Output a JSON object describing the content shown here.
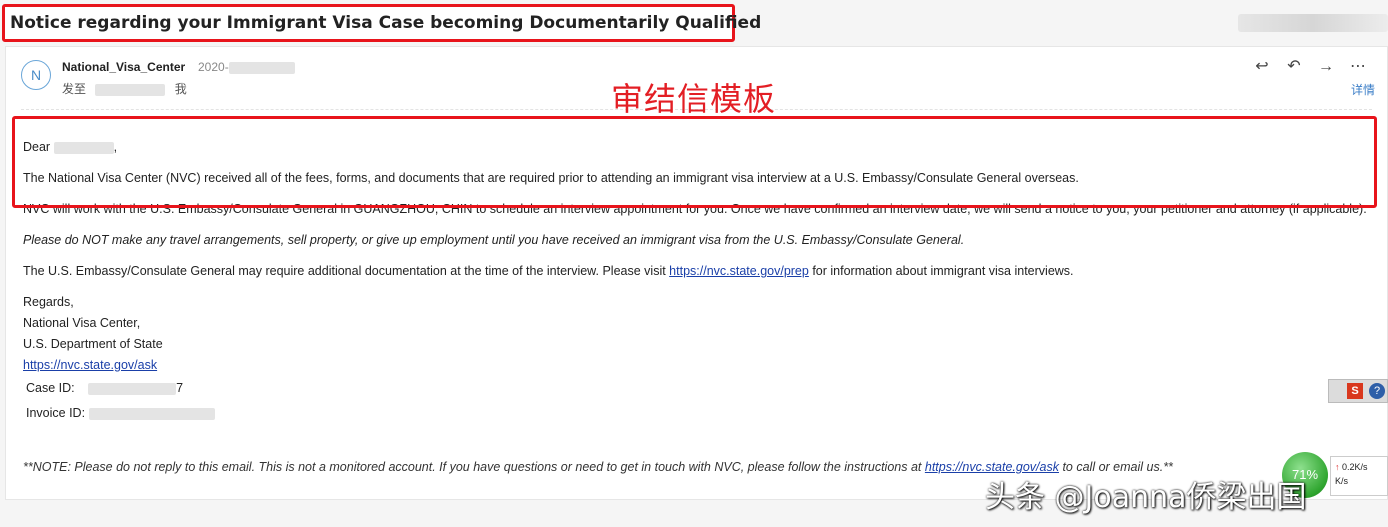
{
  "email": {
    "subject": "Notice regarding your Immigrant Visa Case becoming Documentarily Qualified",
    "sender_initial": "N",
    "sender_name": "National_Visa_Center",
    "date_prefix": "2020-",
    "sent_to_label": "发至",
    "sent_to_me": "我",
    "details_label": "详情",
    "greeting": "Dear",
    "para1": "The National Visa Center (NVC) received all of the fees, forms, and documents that are required prior to attending an immigrant visa interview at a U.S. Embassy/Consulate General overseas.",
    "para2": "NVC will work with the U.S. Embassy/Consulate General in GUANGZHOU, CHIN to schedule an interview appointment for you. Once we have confirmed an interview date, we will send a notice to you, your petitioner and attorney (if applicable).",
    "para3": "Please do NOT make any travel arrangements, sell property, or give up employment until you have received an immigrant visa from the U.S. Embassy/Consulate General.",
    "para4_before": "The U.S. Embassy/Consulate General may require additional documentation at the time of the interview. Please visit ",
    "para4_link": "https://nvc.state.gov/prep",
    "para4_after": " for information about immigrant visa interviews.",
    "regards": "Regards,",
    "sig_org": "National Visa Center,",
    "sig_dept": "U.S. Department of State",
    "sig_link": "https://nvc.state.gov/ask",
    "case_id_label": "Case ID:",
    "case_id_tail": "7",
    "invoice_id_label": "Invoice ID:",
    "note_before": "**NOTE: Please do not reply to this email. This is not a monitored account. If you have questions or need to get in touch with NVC, please follow the instructions at ",
    "note_link": "https://nvc.state.gov/ask",
    "note_after": " to call or email us.**"
  },
  "annotation": {
    "title_cn": "审结信模板"
  },
  "toolbar_icons": [
    "reply-icon",
    "reply-all-icon",
    "forward-icon",
    "more-icon"
  ],
  "widgets": {
    "sogou": "S",
    "help": "?",
    "meter_percent": "71%",
    "upload_speed": "0.2K/s",
    "download_speed": "K/s"
  },
  "brand_watermark": "头条 @Joanna侨梁出国"
}
